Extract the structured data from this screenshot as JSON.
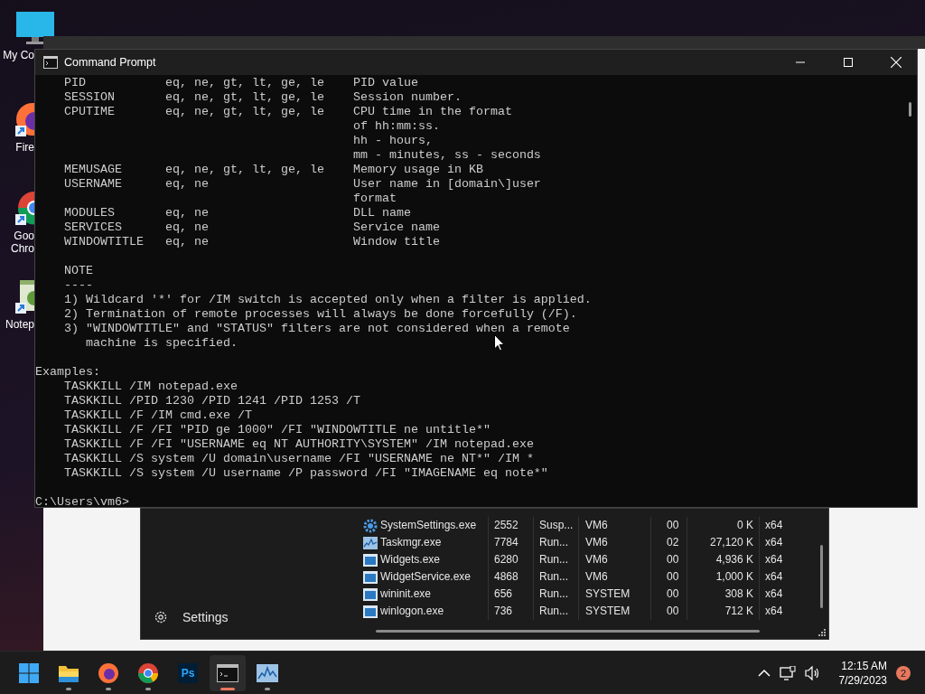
{
  "desktop_icons": [
    {
      "kind": "computer",
      "lines": [
        "My Co"
      ]
    },
    {
      "kind": "firefox",
      "lines": [
        "Fire"
      ]
    },
    {
      "kind": "chrome",
      "lines": [
        "Goo",
        "Chro"
      ]
    },
    {
      "kind": "notepad",
      "lines": [
        "Notep"
      ]
    }
  ],
  "command_prompt": {
    "title": "Command Prompt",
    "blocks": [
      [
        "    PID           eq, ne, gt, lt, ge, le    PID value",
        "    SESSION       eq, ne, gt, lt, ge, le    Session number.",
        "    CPUTIME       eq, ne, gt, lt, ge, le    CPU time in the format",
        "                                            of hh:mm:ss.",
        "                                            hh - hours,",
        "                                            mm - minutes, ss - seconds",
        "    MEMUSAGE      eq, ne, gt, lt, ge, le    Memory usage in KB",
        "    USERNAME      eq, ne                    User name in [domain\\]user",
        "                                            format",
        "    MODULES       eq, ne                    DLL name",
        "    SERVICES      eq, ne                    Service name",
        "    WINDOWTITLE   eq, ne                    Window title"
      ],
      [
        "    NOTE",
        "    ----",
        "    1) Wildcard '*' for /IM switch is accepted only when a filter is applied.",
        "    2) Termination of remote processes will always be done forcefully (/F).",
        "    3) \"WINDOWTITLE\" and \"STATUS\" filters are not considered when a remote",
        "       machine is specified."
      ],
      [
        "Examples:",
        "    TASKKILL /IM notepad.exe",
        "    TASKKILL /PID 1230 /PID 1241 /PID 1253 /T",
        "    TASKKILL /F /IM cmd.exe /T",
        "    TASKKILL /F /FI \"PID ge 1000\" /FI \"WINDOWTITLE ne untitle*\"",
        "    TASKKILL /F /FI \"USERNAME eq NT AUTHORITY\\SYSTEM\" /IM notepad.exe",
        "    TASKKILL /S system /U domain\\username /FI \"USERNAME ne NT*\" /IM *",
        "    TASKKILL /S system /U username /P password /FI \"IMAGENAME eq note*\""
      ],
      [
        "C:\\Users\\vm6>"
      ]
    ]
  },
  "task_manager": {
    "nav_settings": "Settings",
    "rows": [
      {
        "kind": "settings",
        "name": "SystemSettings.exe",
        "pid": "2552",
        "status": "Susp...",
        "user": "VM6",
        "cpu": "00",
        "memory": "0 K",
        "arch": "x64"
      },
      {
        "kind": "taskmgr",
        "name": "Taskmgr.exe",
        "pid": "7784",
        "status": "Run...",
        "user": "VM6",
        "cpu": "02",
        "memory": "27,120 K",
        "arch": "x64"
      },
      {
        "kind": "app",
        "name": "Widgets.exe",
        "pid": "6280",
        "status": "Run...",
        "user": "VM6",
        "cpu": "00",
        "memory": "4,936 K",
        "arch": "x64"
      },
      {
        "kind": "app",
        "name": "WidgetService.exe",
        "pid": "4868",
        "status": "Run...",
        "user": "VM6",
        "cpu": "00",
        "memory": "1,000 K",
        "arch": "x64"
      },
      {
        "kind": "app",
        "name": "wininit.exe",
        "pid": "656",
        "status": "Run...",
        "user": "SYSTEM",
        "cpu": "00",
        "memory": "308 K",
        "arch": "x64"
      },
      {
        "kind": "app",
        "name": "winlogon.exe",
        "pid": "736",
        "status": "Run...",
        "user": "SYSTEM",
        "cpu": "00",
        "memory": "712 K",
        "arch": "x64"
      }
    ]
  },
  "taskbar": {
    "apps": [
      {
        "kind": "start",
        "running": false,
        "selected": false
      },
      {
        "kind": "explorer",
        "running": true,
        "selected": false
      },
      {
        "kind": "firefox",
        "running": true,
        "selected": false
      },
      {
        "kind": "chrome",
        "running": true,
        "selected": false
      },
      {
        "kind": "photoshop",
        "label": "Ps",
        "running": false,
        "selected": false
      },
      {
        "kind": "terminal",
        "running": true,
        "selected": true
      },
      {
        "kind": "taskmgr",
        "running": true,
        "selected": false
      }
    ],
    "time": "12:15 AM",
    "date": "7/29/2023",
    "notifications": "2"
  }
}
